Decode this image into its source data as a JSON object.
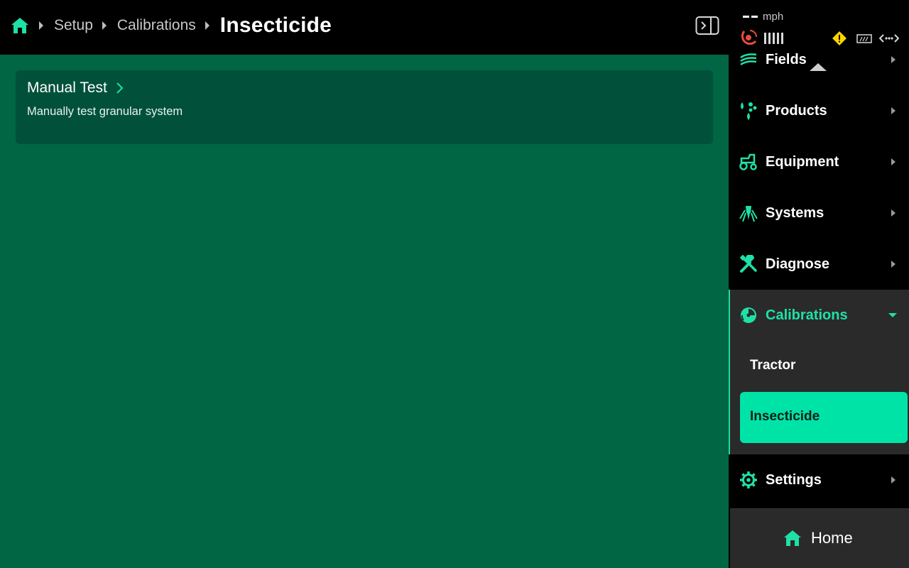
{
  "breadcrumb": {
    "items": [
      "Setup",
      "Calibrations"
    ],
    "current": "Insecticide"
  },
  "card": {
    "title": "Manual Test",
    "subtitle": "Manually test granular system"
  },
  "status": {
    "speed_value": "--",
    "speed_unit": "mph"
  },
  "nav": {
    "fields": "Fields",
    "products": "Products",
    "equipment": "Equipment",
    "systems": "Systems",
    "diagnose": "Diagnose",
    "calibrations": "Calibrations",
    "calibration_items": [
      "Tractor",
      "Insecticide"
    ],
    "settings": "Settings"
  },
  "home_button": {
    "label": "Home"
  },
  "colors": {
    "accent": "#1fe0a6",
    "main_bg": "#006644",
    "card_bg": "#01513a",
    "panel_bg": "#000000",
    "active_bg": "#00e3a6",
    "group_bg": "#2a2a2a",
    "warning": "#ffd400",
    "gps_alert": "#e84c3d"
  },
  "icons": [
    "home-icon",
    "panel-toggle-icon",
    "gps-icon",
    "signal-icon",
    "warning-icon",
    "implement-icon",
    "connection-icon",
    "fields-icon",
    "products-icon",
    "equipment-icon",
    "systems-icon",
    "diagnose-icon",
    "calibrations-icon",
    "settings-icon"
  ]
}
